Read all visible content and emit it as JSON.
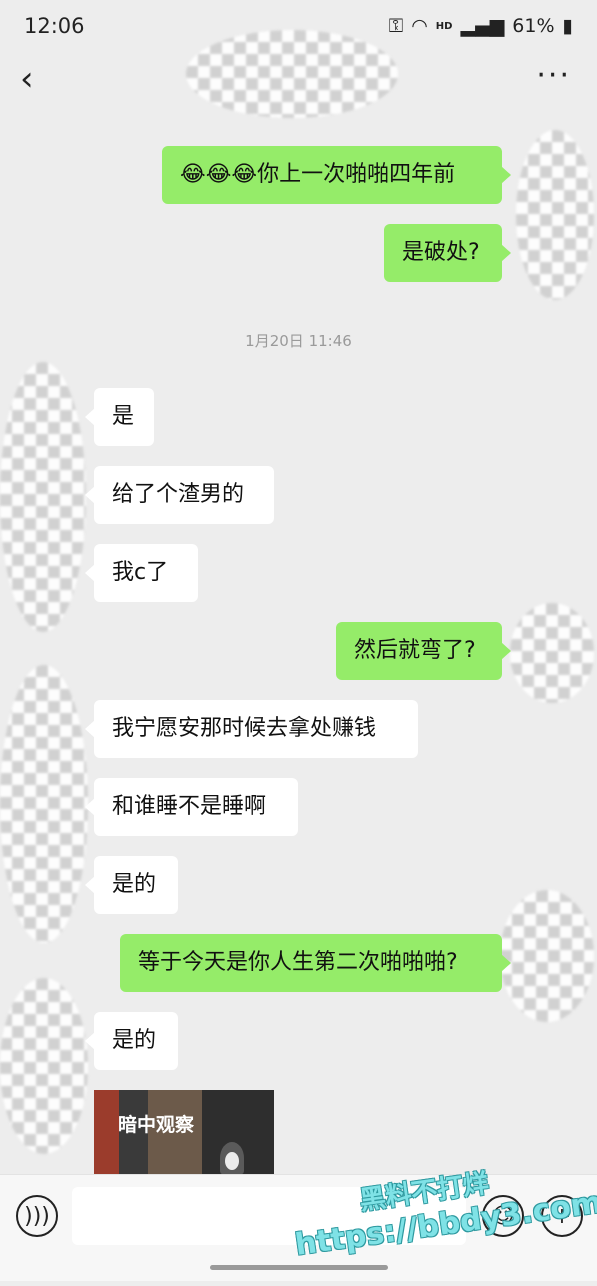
{
  "status_bar": {
    "time": "12:06",
    "network_label": "HD",
    "battery": "61%"
  },
  "nav": {
    "back_glyph": "‹",
    "more_glyph": "···"
  },
  "messages": [
    {
      "dir": "out",
      "text": "😂😂😂你上一次啪啪四年前"
    },
    {
      "dir": "out",
      "text": "是破处?"
    },
    {
      "dir": "in",
      "text": "是"
    },
    {
      "dir": "in",
      "text": "给了个渣男的"
    },
    {
      "dir": "in",
      "text": "我c了"
    },
    {
      "dir": "out",
      "text": "然后就弯了?"
    },
    {
      "dir": "in",
      "text": "我宁愿安那时候去拿处赚钱"
    },
    {
      "dir": "in",
      "text": "和谁睡不是睡啊"
    },
    {
      "dir": "in",
      "text": "是的"
    },
    {
      "dir": "out",
      "text": "等于今天是你人生第二次啪啪啪?"
    },
    {
      "dir": "in",
      "text": "是的"
    }
  ],
  "timestamp": "1月20日 11:46",
  "sticker": {
    "caption": "暗中观察"
  },
  "input_bar": {
    "placeholder": "",
    "voice_icon": "voice-icon",
    "emoji_icon": "emoji-icon",
    "plus_icon": "plus-icon"
  },
  "watermark": {
    "line1": "黑料不打烊",
    "line2": "https://bbdy3.com"
  }
}
